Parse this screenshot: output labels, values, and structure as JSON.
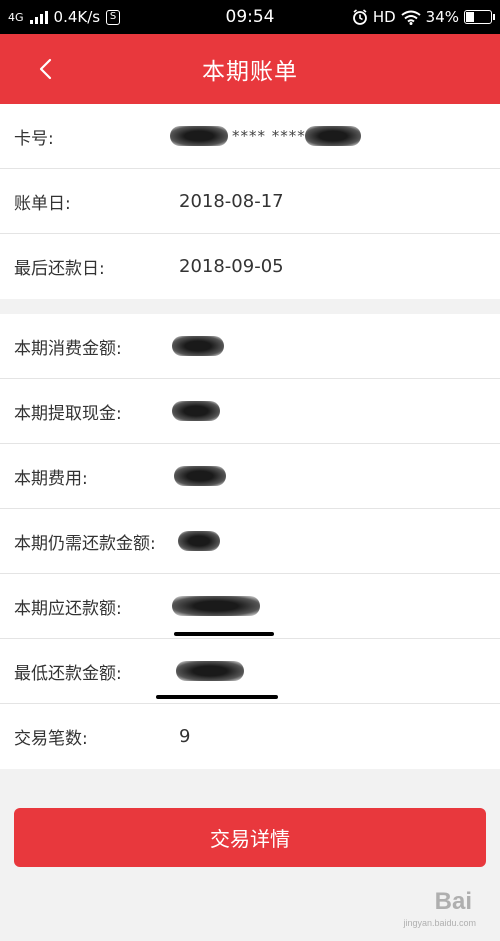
{
  "status_bar": {
    "network": "4G",
    "speed": "0.4K/s",
    "speed_icon": "S",
    "time": "09:54",
    "hd": "HD",
    "battery": "34%",
    "battery_level": 0.34
  },
  "nav": {
    "title": "本期账单",
    "back_icon": "chevron-left-icon"
  },
  "card_section": {
    "card_number": {
      "label": "卡号:",
      "value_visible": "**** ****"
    },
    "statement_date": {
      "label": "账单日:",
      "value": "2018-08-17"
    },
    "due_date": {
      "label": "最后还款日:",
      "value": "2018-09-05"
    }
  },
  "amount_section": {
    "spending": {
      "label": "本期消费金额:"
    },
    "cash_withdrawal": {
      "label": "本期提取现金:"
    },
    "fees": {
      "label": "本期费用:"
    },
    "remaining_due": {
      "label": "本期仍需还款金额:"
    },
    "payable": {
      "label": "本期应还款额:"
    },
    "minimum_payment": {
      "label": "最低还款金额:"
    },
    "transaction_count": {
      "label": "交易笔数:",
      "value": "9"
    }
  },
  "actions": {
    "detail_label": "交易详情"
  },
  "watermark": {
    "brand": "Bai",
    "sub": "jingyan.baidu.com"
  },
  "colors": {
    "accent": "#e8383d",
    "background": "#f2f2f2"
  }
}
